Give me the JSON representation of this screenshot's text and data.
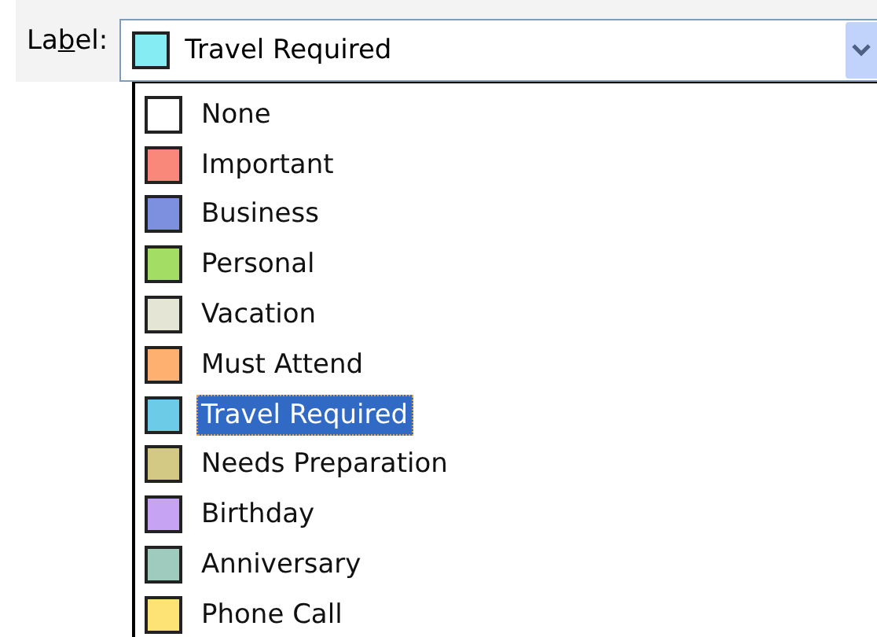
{
  "label": {
    "parts": [
      {
        "text": "La",
        "underlined": false
      },
      {
        "text": "b",
        "underlined": true
      },
      {
        "text": "el:",
        "underlined": false
      }
    ]
  },
  "combo": {
    "value": "Travel Required",
    "color": "#86ecf4"
  },
  "options": [
    {
      "text": "None",
      "color": "#ffffff",
      "selected": false
    },
    {
      "text": "Important",
      "color": "#f9887a",
      "selected": false
    },
    {
      "text": "Business",
      "color": "#7d90e0",
      "selected": false
    },
    {
      "text": "Personal",
      "color": "#a3dd64",
      "selected": false
    },
    {
      "text": "Vacation",
      "color": "#e5e5d5",
      "selected": false
    },
    {
      "text": "Must Attend",
      "color": "#feb070",
      "selected": false
    },
    {
      "text": "Travel Required",
      "color": "#6ccbe6",
      "selected": true
    },
    {
      "text": "Needs Preparation",
      "color": "#d3c985",
      "selected": false
    },
    {
      "text": "Birthday",
      "color": "#c6a4f3",
      "selected": false
    },
    {
      "text": "Anniversary",
      "color": "#9ecbbe",
      "selected": false
    },
    {
      "text": "Phone Call",
      "color": "#fde375",
      "selected": false
    }
  ]
}
